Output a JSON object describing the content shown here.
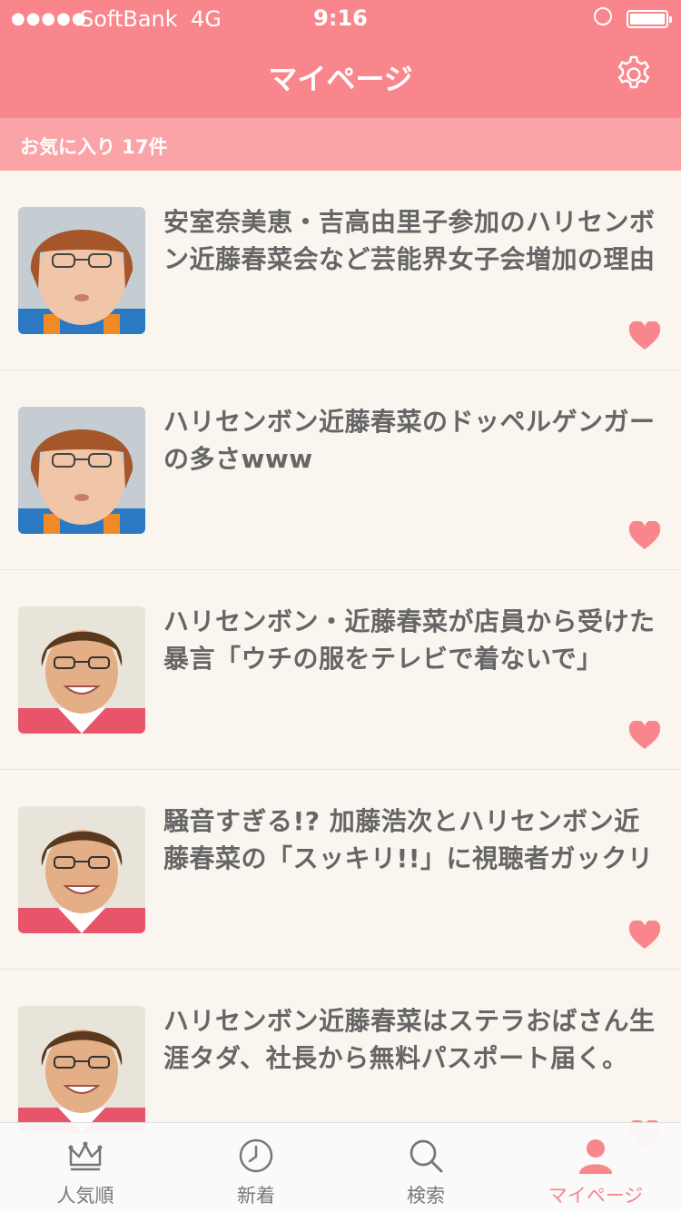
{
  "status_bar": {
    "signal_dots": "●●●●●",
    "carrier": "SoftBank",
    "network": "4G",
    "time": "9:16"
  },
  "nav": {
    "title": "マイページ",
    "settings_icon": "gear-icon"
  },
  "favorites": {
    "label": "お気に入り 17件"
  },
  "articles": [
    {
      "title": "安室奈美恵・吉高由里子参加のハリセンボン近藤春菜会など芸能界女子会増加の理由",
      "favorited": true
    },
    {
      "title": "ハリセンボン近藤春菜のドッペルゲンガーの多さwww",
      "favorited": true
    },
    {
      "title": "ハリセンボン・近藤春菜が店員から受けた暴言「ウチの服をテレビで着ないで」",
      "favorited": true
    },
    {
      "title": "騒音すぎる!? 加藤浩次とハリセンボン近藤春菜の「スッキリ!!」に視聴者ガックリ",
      "favorited": true
    },
    {
      "title": "ハリセンボン近藤春菜はステラおばさん生涯タダ、社長から無料パスポート届く。",
      "favorited": true
    }
  ],
  "tabs": [
    {
      "label": "人気順",
      "icon": "crown-icon",
      "active": false
    },
    {
      "label": "新着",
      "icon": "clock-icon",
      "active": false
    },
    {
      "label": "検索",
      "icon": "search-icon",
      "active": false
    },
    {
      "label": "マイページ",
      "icon": "person-icon",
      "active": true
    }
  ],
  "colors": {
    "brand": "#f9868c",
    "subheader": "#fba4a8",
    "heart": "#f9868c",
    "background": "#faf6ef"
  }
}
